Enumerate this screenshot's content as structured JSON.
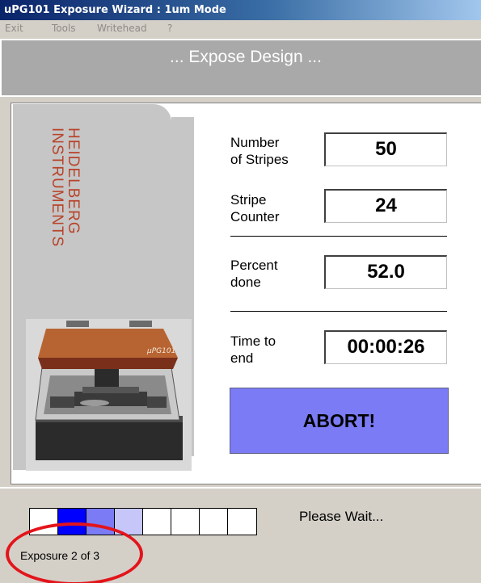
{
  "window": {
    "title": "uPG101 Exposure Wizard : 1um Mode"
  },
  "menu": {
    "items": [
      "Exit",
      "Tools",
      "Writehead",
      "?"
    ]
  },
  "banner": {
    "text": "... Expose Design ..."
  },
  "brand": {
    "line1": "HEIDELBERG",
    "line2": "INSTRUMENTS",
    "color": "#b8432a"
  },
  "machine": {
    "label": "µPG101"
  },
  "fields": [
    {
      "label1": "Number",
      "label2": "of Stripes",
      "value": "50"
    },
    {
      "label1": "Stripe",
      "label2": "Counter",
      "value": "24"
    },
    {
      "label1": "Percent",
      "label2": "done",
      "value": "52.0"
    },
    {
      "label1": "Time to",
      "label2": "end",
      "value": "00:00:26"
    }
  ],
  "abort": {
    "label": "ABORT!",
    "color": "#7a7bf5"
  },
  "status": {
    "message": "Please Wait...",
    "exposure": "Exposure 2 of 3",
    "segments": [
      "done",
      "active",
      "mid",
      "light",
      "empty",
      "empty",
      "empty",
      "empty"
    ],
    "segment_colors": {
      "done": "#ffffff",
      "active": "#0000ff",
      "mid": "#7a7bf5",
      "light": "#c6c6f8",
      "empty": "#ffffff"
    },
    "highlight_color": "#e3141b"
  }
}
